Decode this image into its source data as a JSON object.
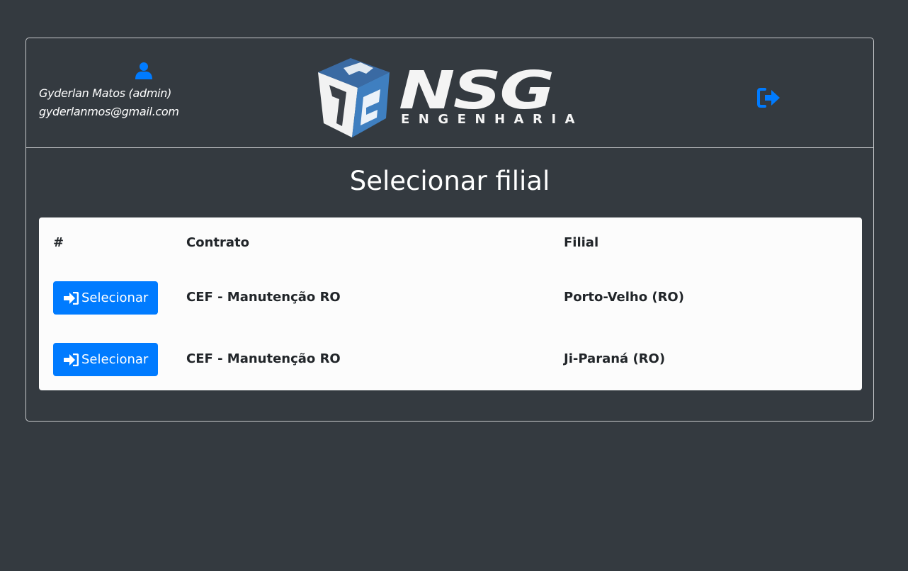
{
  "user": {
    "name": "Gyderlan Matos (admin)",
    "email": "gyderlanmos@gmail.com",
    "icon": "user-icon"
  },
  "logo": {
    "brand": "NSG",
    "sub": "ENGENHARIA"
  },
  "header": {
    "logout_icon": "sign-out-icon"
  },
  "page": {
    "title": "Selecionar filial"
  },
  "table": {
    "columns": [
      "#",
      "Contrato",
      "Filial"
    ],
    "rows": [
      {
        "action": "Selecionar",
        "contrato": "CEF - Manutenção RO",
        "filial": "Porto-Velho (RO)"
      },
      {
        "action": "Selecionar",
        "contrato": "CEF - Manutenção RO",
        "filial": "Ji-Paraná (RO)"
      }
    ]
  },
  "colors": {
    "background": "#343a40",
    "primary": "#007bff",
    "table_bg": "#fcfcfc",
    "text_dark": "#212529",
    "logo_blue": "#3f7fc0"
  }
}
